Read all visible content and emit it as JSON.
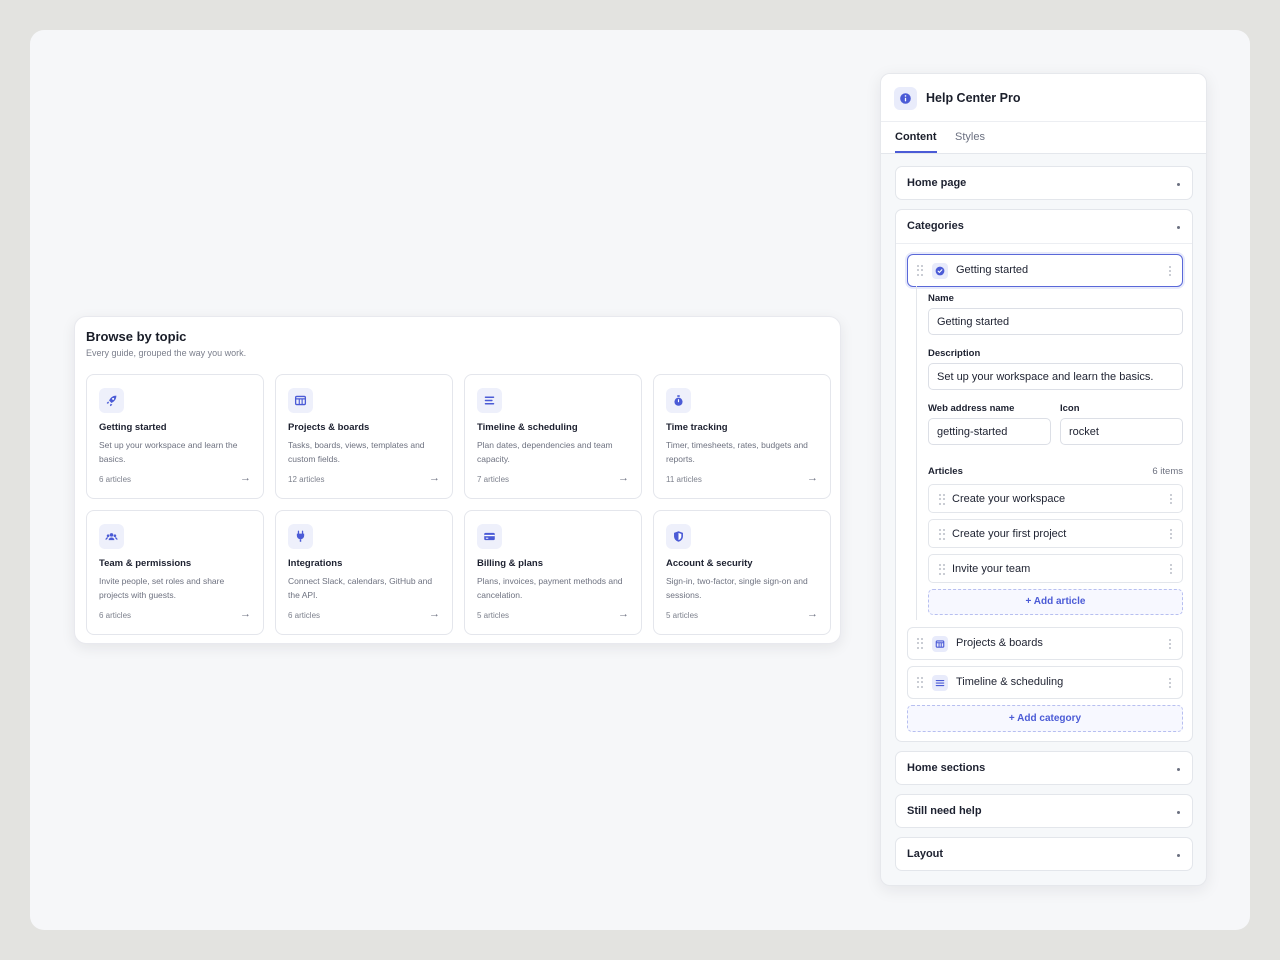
{
  "preview": {
    "title": "Browse by topic",
    "subtitle": "Every guide, grouped the way you work.",
    "topics": [
      {
        "name": "Getting started",
        "description": "Set up your workspace and learn the basics.",
        "count": "6 articles",
        "icon": "rocket-icon"
      },
      {
        "name": "Projects & boards",
        "description": "Tasks, boards, views, templates and custom fields.",
        "count": "12 articles",
        "icon": "board-icon"
      },
      {
        "name": "Timeline & scheduling",
        "description": "Plan dates, dependencies and team capacity.",
        "count": "7 articles",
        "icon": "timeline-icon"
      },
      {
        "name": "Time tracking",
        "description": "Timer, timesheets, rates, budgets and reports.",
        "count": "11 articles",
        "icon": "stopwatch-icon"
      },
      {
        "name": "Team & permissions",
        "description": "Invite people, set roles and share projects with guests.",
        "count": "6 articles",
        "icon": "team-icon"
      },
      {
        "name": "Integrations",
        "description": "Connect Slack, calendars, GitHub and the API.",
        "count": "6 articles",
        "icon": "plug-icon"
      },
      {
        "name": "Billing & plans",
        "description": "Plans, invoices, payment methods and cancelation.",
        "count": "5 articles",
        "icon": "card-icon"
      },
      {
        "name": "Account & security",
        "description": "Sign-in, two-factor, single sign-on and sessions.",
        "count": "5 articles",
        "icon": "shield-icon"
      }
    ]
  },
  "panel": {
    "title": "Help Center Pro",
    "tabs": [
      "Content",
      "Styles"
    ],
    "sections": {
      "home_page": "Home page",
      "categories": "Categories",
      "home_sections": "Home sections",
      "still_need_help": "Still need help",
      "layout": "Layout"
    },
    "categories": [
      {
        "name": "Getting started",
        "icon": "check-badge-icon"
      },
      {
        "name": "Projects & boards",
        "icon": "board-icon"
      },
      {
        "name": "Timeline & scheduling",
        "icon": "timeline-icon"
      }
    ],
    "detail": {
      "name_label": "Name",
      "name_value": "Getting started",
      "description_label": "Description",
      "description_value": "Set up your workspace and learn the basics.",
      "slug_label": "Web address name",
      "slug_value": "getting-started",
      "icon_label": "Icon",
      "icon_value": "rocket",
      "articles_label": "Articles",
      "articles_count": "6 items",
      "articles": [
        "Create your workspace",
        "Create your first project",
        "Invite your team"
      ],
      "add_article": "+ Add article"
    },
    "add_category": "+ Add category"
  },
  "colors": {
    "accent": "#4b5bd6",
    "accent_soft": "#eef0fb"
  }
}
